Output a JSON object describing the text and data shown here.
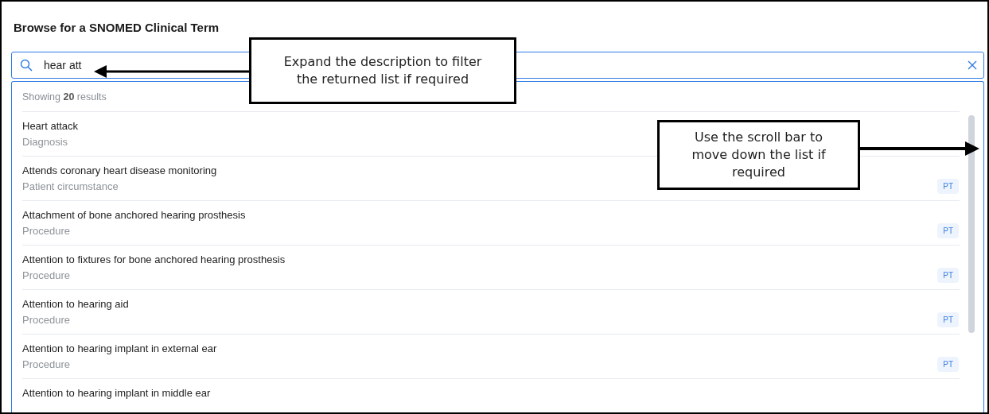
{
  "dialog": {
    "title": "Browse for a SNOMED Clinical Term"
  },
  "search": {
    "value": "hear att"
  },
  "results": {
    "summary": "Showing **20** results",
    "items": [
      {
        "term": "Heart attack",
        "category": "Diagnosis"
      },
      {
        "term": "Attends coronary heart disease monitoring",
        "category": "Patient circumstance",
        "badge": "PT"
      },
      {
        "term": "Attachment of bone anchored hearing prosthesis",
        "category": "Procedure",
        "badge": "PT"
      },
      {
        "term": "Attention to fixtures for bone anchored hearing prosthesis",
        "category": "Procedure",
        "badge": "PT"
      },
      {
        "term": "Attention to hearing aid",
        "category": "Procedure",
        "badge": "PT"
      },
      {
        "term": "Attention to hearing implant in external ear",
        "category": "Procedure",
        "badge": "PT"
      },
      {
        "term": "Attention to hearing implant in middle ear"
      }
    ]
  },
  "callouts": [
    {
      "text": "Expand the description to filter the returned list if required",
      "kind": "left"
    },
    {
      "text": "Use the scroll bar to move down the list if required",
      "kind": "right"
    }
  ]
}
